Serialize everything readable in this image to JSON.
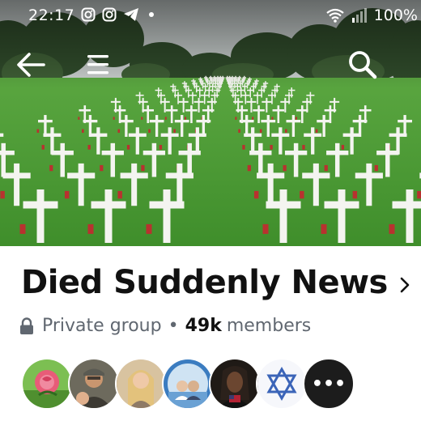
{
  "status_bar": {
    "time": "22:17",
    "left_icons": [
      "instagram-icon",
      "instagram-icon",
      "telegram-icon",
      "dot-icon"
    ],
    "right_icons": [
      "wifi-icon",
      "signal-icon"
    ],
    "battery": "100%"
  },
  "app_bar": {
    "back_icon": "arrow-left-icon",
    "menu_icon": "hamburger-menu-icon",
    "search_icon": "search-icon"
  },
  "cover": {
    "scene": "military cemetery with rows of white crosses and small flags on green lawn"
  },
  "group": {
    "name": "Died Suddenly News",
    "privacy": "Private group",
    "separator": "•",
    "member_count": "49k",
    "member_label": "members"
  },
  "avatars": [
    {
      "name": "avatar-rose",
      "color": "#6fb34a"
    },
    {
      "name": "avatar-man-cap",
      "color": "#8a6a4a"
    },
    {
      "name": "avatar-woman-blonde",
      "color": "#d9b07a"
    },
    {
      "name": "avatar-couple",
      "color": "#7aa6d0"
    },
    {
      "name": "avatar-man-dreadlocks",
      "color": "#3a2a22"
    },
    {
      "name": "avatar-star-of-david",
      "color": "#ffffff"
    },
    {
      "name": "avatar-more",
      "label": "•••"
    }
  ],
  "colors": {
    "grass": "#4a9b34",
    "sky": "#d8dcdc",
    "cross": "#f4f4f0",
    "title": "#111111",
    "meta": "#606770"
  }
}
